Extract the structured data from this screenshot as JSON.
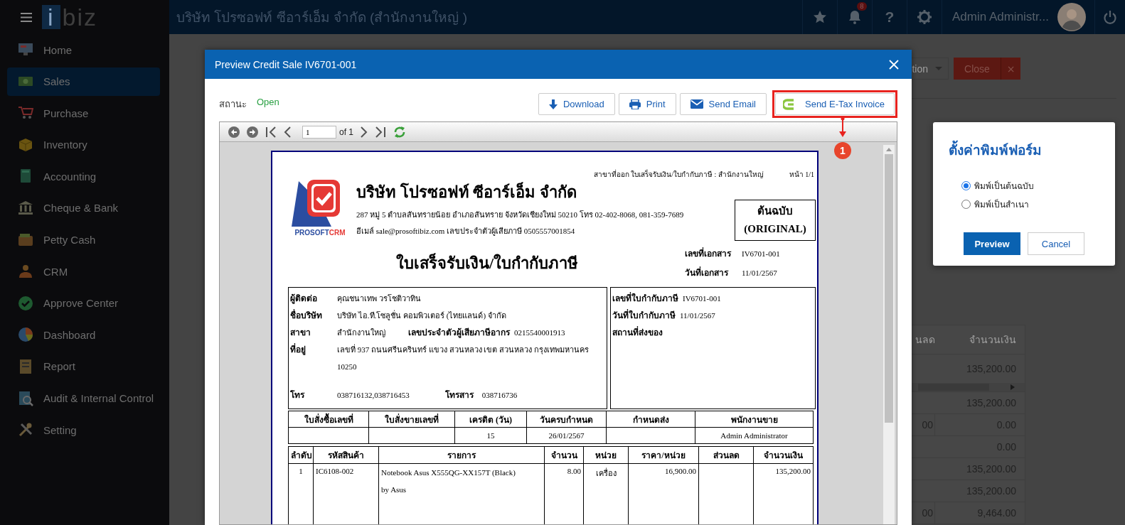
{
  "app": {
    "logo_mark": "i",
    "logo_text": "biz",
    "company": "บริษัท โปรซอฟท์ ซีอาร์เอ็ม จำกัด (สำนักงานใหญ่ )",
    "notifications": "8",
    "help": "?",
    "user": "Admin Administr..."
  },
  "sidebar": {
    "items": [
      {
        "label": "Home",
        "selected": false
      },
      {
        "label": "Sales",
        "selected": true
      },
      {
        "label": "Purchase",
        "selected": false
      },
      {
        "label": "Inventory",
        "selected": false
      },
      {
        "label": "Accounting",
        "selected": false
      },
      {
        "label": "Cheque & Bank",
        "selected": false
      },
      {
        "label": "Petty Cash",
        "selected": false
      },
      {
        "label": "CRM",
        "selected": false
      },
      {
        "label": "Approve Center",
        "selected": false
      },
      {
        "label": "Dashboard",
        "selected": false
      },
      {
        "label": "Report",
        "selected": false
      },
      {
        "label": "Audit & Internal Control",
        "selected": false
      },
      {
        "label": "Setting",
        "selected": false
      }
    ]
  },
  "background": {
    "action_button": "tion",
    "close_button": "Close",
    "close_x": "×",
    "columns": [
      "นลด",
      "จำนวนเงิน"
    ],
    "rows": [
      {
        "amount": "135,200.00"
      },
      {
        "amount": "135,200.00"
      },
      {
        "column_1": "00",
        "amount": "0.00"
      },
      {
        "amount": "0.00"
      },
      {
        "amount": "135,200.00"
      },
      {
        "amount": "135,200.00"
      },
      {
        "column_1": "00",
        "amount": "9,464.00"
      }
    ]
  },
  "modal": {
    "title": "Preview Credit Sale IV6701-001",
    "status_label": "สถานะ",
    "status": "Open",
    "buttons": [
      {
        "label": "Download",
        "highlighted": false
      },
      {
        "label": "Print",
        "highlighted": false
      },
      {
        "label": "Send Email",
        "highlighted": false
      },
      {
        "label": "Send E-Tax Invoice",
        "highlighted": true
      }
    ],
    "callout": "1",
    "toolbar": {
      "page": "1",
      "of": "of 1"
    },
    "document": {
      "branch_line": "สาขาที่ออก ใบเสร็จรับเงิน/ใบกำกับภาษี : สำนักงานใหญ่",
      "page": "หน้า 1/1",
      "logo_text": "PROSOFT",
      "logo_accent": "CRM",
      "company_name": "บริษัท โปรซอฟท์ ซีอาร์เอ็ม จำกัด",
      "address": "287 หมู่ 5 ตำบลสันทรายน้อย อำเภอสันทราย จังหวัดเชียงใหม่ 50210 โทร 02-402-8068, 081-359-7689",
      "contact": "อีเมล์ sale@prosoftibiz.com เลขประจำตัวผู้เสียภาษี 0505557001854",
      "copy_label": [
        "ต้นฉบับ",
        "(ORIGINAL)"
      ],
      "title": "ใบเสร็จรับเงิน/ใบกำกับภาษี",
      "doc_fields": [
        {
          "label": "เลขที่เอกสาร",
          "value": "IV6701-001"
        },
        {
          "label": "วันที่เอกสาร",
          "value": "11/01/2567"
        }
      ],
      "customer": [
        {
          "label": "ผู้ติดต่อ",
          "lines": [
            "คุณชนาเทพ วรโชติวาทิน"
          ]
        },
        {
          "label": "ชื่อบริษัท",
          "lines": [
            "บริษัท ไอ.ที.โซลูชั่น คอมพิวเตอร์ (ไทยแลนด์) จำกัด"
          ]
        },
        {
          "label": "สาขา",
          "lines": [
            "สำนักงานใหญ่"
          ],
          "extra_label": "เลขประจำตัวผู้เสียภาษีอากร",
          "extra_value": "0215540001913"
        },
        {
          "label": "ที่อยู่",
          "lines": [
            "เลขที่ 937 ถนนศรีนครินทร์ แขวง สวนหลวง เขต สวนหลวง กรุงเทพมหานคร",
            "10250"
          ]
        }
      ],
      "phone": {
        "label": "โทร",
        "value": "038716132,038716453",
        "fax_label": "โทรสาร",
        "fax_value": "038716736"
      },
      "tax_invoice": [
        {
          "label": "เลขที่ใบกำกับภาษี",
          "value": "IV6701-001"
        },
        {
          "label": "วันที่ใบกำกับภาษี",
          "value": "11/01/2567"
        },
        {
          "label": "สถานที่ส่งของ"
        }
      ],
      "order_info": [
        {
          "heading": "ใบสั่งซื้อเลขที่"
        },
        {
          "heading": "ใบสั่งขายเลขที่"
        },
        {
          "heading": "เครดิต (วัน)",
          "value": "15"
        },
        {
          "heading": "วันครบกำหนด",
          "value": "26/01/2567"
        },
        {
          "heading": "กำหนดส่ง"
        },
        {
          "heading": "พนักงานขาย",
          "value": "Admin Administrator"
        }
      ],
      "item_columns": [
        "ลำดับ",
        "รหัสสินค้า",
        "รายการ",
        "จำนวน",
        "หน่วย",
        "ราคา/หน่วย",
        "ส่วนลด",
        "จำนวนเงิน"
      ],
      "items": [
        {
          "no": "1",
          "code": "IC6108-002",
          "description_lines": [
            "Notebook Asus X555QG-XX157T (Black)",
            "by Asus"
          ],
          "qty": "8.00",
          "unit": "เครื่อง",
          "price": "16,900.00",
          "amount": "135,200.00"
        }
      ]
    }
  },
  "print_dialog": {
    "title": "ตั้งค่าพิมพ์ฟอร์ม",
    "options": [
      {
        "label": "พิมพ์เป็นต้นฉบับ",
        "selected": true
      },
      {
        "label": "พิมพ์เป็นสำเนา",
        "selected": false
      }
    ],
    "buttons": [
      {
        "label": "Preview",
        "kind": "primary"
      },
      {
        "label": "Cancel",
        "kind": "secondary"
      }
    ]
  }
}
